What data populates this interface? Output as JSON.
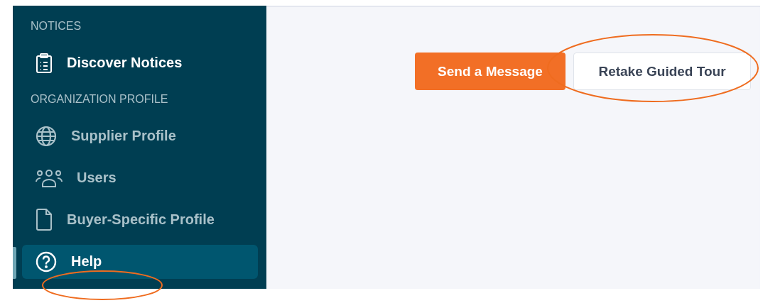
{
  "sidebar": {
    "sections": [
      {
        "label": "NOTICES",
        "items": [
          {
            "label": "Discover Notices",
            "kind": "clipboard",
            "active": true,
            "selected": false,
            "circled": false
          }
        ]
      },
      {
        "label": "ORGANIZATION PROFILE",
        "items": [
          {
            "label": "Supplier Profile",
            "kind": "globe",
            "active": false,
            "selected": false,
            "circled": false
          },
          {
            "label": "Users",
            "kind": "users",
            "active": false,
            "selected": false,
            "circled": false
          },
          {
            "label": "Buyer-Specific Profile",
            "kind": "file",
            "active": false,
            "selected": false,
            "circled": false
          },
          {
            "label": "Help",
            "kind": "help",
            "active": false,
            "selected": true,
            "circled": true
          }
        ]
      }
    ]
  },
  "actions": [
    {
      "label": "Send a Message",
      "kind": "primary",
      "circled": false
    },
    {
      "label": "Retake Guided Tour",
      "kind": "secondary",
      "circled": true
    }
  ]
}
